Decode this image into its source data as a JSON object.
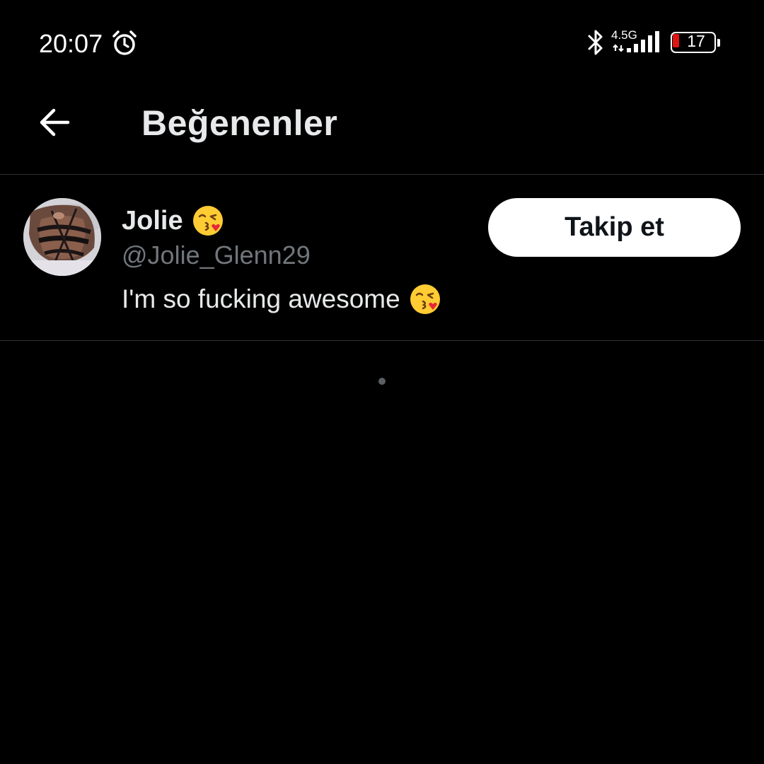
{
  "status_bar": {
    "time": "20:07",
    "network": "4.5G",
    "battery_level": "17",
    "battery_color": "#e01414",
    "icons": [
      "alarm-icon",
      "bluetooth-icon",
      "signal-icon",
      "battery-icon"
    ]
  },
  "header": {
    "title": "Beğenenler",
    "back_icon": "arrow-left-icon"
  },
  "users": [
    {
      "display_name": "Jolie",
      "name_emoji": "face-blowing-kiss-icon",
      "handle": "@Jolie_Glenn29",
      "bio": "I'm so fucking awesome",
      "bio_emoji": "face-blowing-kiss-icon",
      "follow_label": "Takip et"
    }
  ],
  "theme": {
    "background": "#000000",
    "text_primary": "#e7e9ea",
    "text_secondary": "#71767b",
    "divider": "#2f3336",
    "button_bg": "#ffffff",
    "button_text": "#0f1419"
  }
}
